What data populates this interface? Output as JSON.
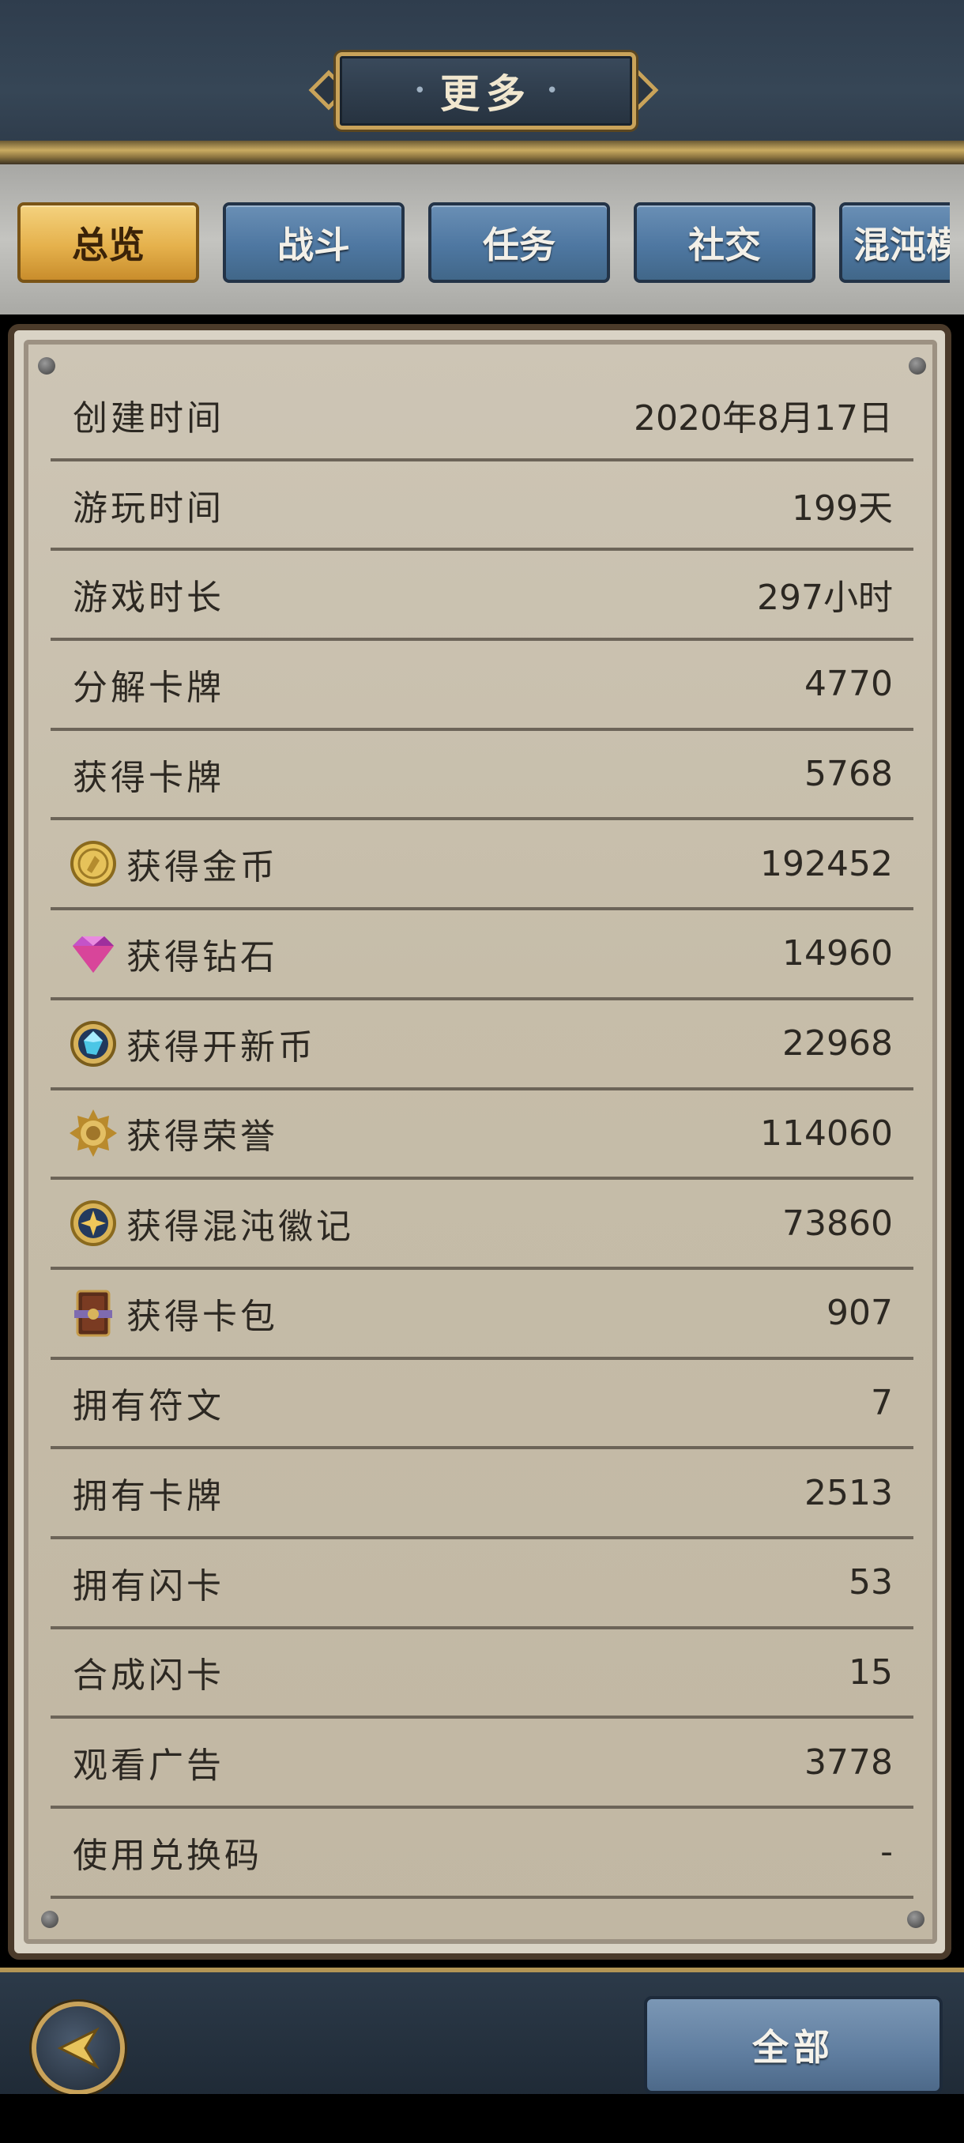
{
  "header": {
    "title": "更多"
  },
  "tabs": [
    {
      "label": "总览",
      "active": true
    },
    {
      "label": "战斗",
      "active": false
    },
    {
      "label": "任务",
      "active": false
    },
    {
      "label": "社交",
      "active": false
    },
    {
      "label": "混沌模",
      "active": false
    }
  ],
  "stats": [
    {
      "label": "创建时间",
      "value": "2020年8月17日",
      "icon": ""
    },
    {
      "label": "游玩时间",
      "value": "199天",
      "icon": ""
    },
    {
      "label": "游戏时长",
      "value": "297小时",
      "icon": ""
    },
    {
      "label": "分解卡牌",
      "value": "4770",
      "icon": ""
    },
    {
      "label": "获得卡牌",
      "value": "5768",
      "icon": ""
    },
    {
      "label": "获得金币",
      "value": "192452",
      "icon": "gold-coin-icon"
    },
    {
      "label": "获得钻石",
      "value": "14960",
      "icon": "diamond-icon"
    },
    {
      "label": "获得开新币",
      "value": "22968",
      "icon": "gem-coin-icon"
    },
    {
      "label": "获得荣誉",
      "value": "114060",
      "icon": "honor-badge-icon"
    },
    {
      "label": "获得混沌徽记",
      "value": "73860",
      "icon": "chaos-emblem-icon"
    },
    {
      "label": "获得卡包",
      "value": "907",
      "icon": "card-pack-icon"
    },
    {
      "label": "拥有符文",
      "value": "7",
      "icon": ""
    },
    {
      "label": "拥有卡牌",
      "value": "2513",
      "icon": ""
    },
    {
      "label": "拥有闪卡",
      "value": "53",
      "icon": ""
    },
    {
      "label": "合成闪卡",
      "value": "15",
      "icon": ""
    },
    {
      "label": "观看广告",
      "value": "3778",
      "icon": ""
    },
    {
      "label": "使用兑换码",
      "value": "-",
      "icon": ""
    }
  ],
  "footer": {
    "all_label": "全部"
  },
  "colors": {
    "accent_gold": "#c9a35a",
    "tab_active": "#e5b14c",
    "tab_inactive": "#4e77a1"
  }
}
